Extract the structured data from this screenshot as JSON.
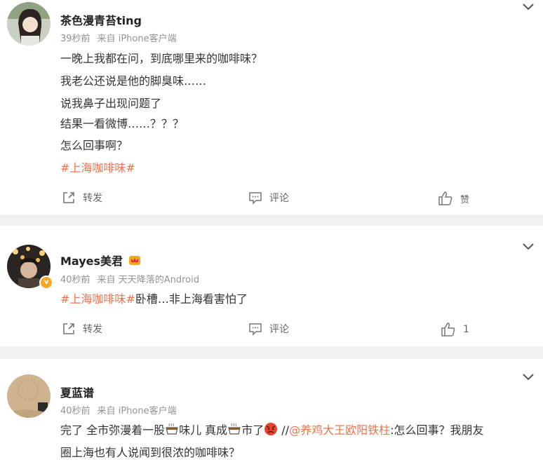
{
  "comments": [
    {
      "username": "茶色漫青苔ting",
      "time": "39秒前",
      "from_prefix": "来自",
      "device": "iPhone客户端",
      "lines": [
        "一晚上我都在问，到底哪里来的咖啡味？",
        "我老公还说是他的脚臭味……",
        "说我鼻子出现问题了",
        "结果一看微博……？？？",
        "怎么回事啊？"
      ],
      "hashtag": "#上海咖啡味#",
      "actions": {
        "forward": "转发",
        "comment": "评论",
        "like": "赞"
      }
    },
    {
      "username": "Mayes美君",
      "time": "40秒前",
      "from_prefix": "来自",
      "device": "天天降落的Android",
      "hashtag": "#上海咖啡味#",
      "text_after_hashtag": "卧槽…非上海看害怕了",
      "actions": {
        "forward": "转发",
        "comment": "评论",
        "like": "1"
      }
    },
    {
      "username": "夏蓝谱",
      "time": "40秒前",
      "from_prefix": "来自",
      "device": "iPhone客户端",
      "line1_a": "完了 全市弥漫着一股",
      "line1_b": "味儿 真成",
      "line1_c": "市了",
      "line1_d": " //",
      "mention": "@养鸡大王欧阳铁柱",
      "line1_e": ":怎么回事？我朋友",
      "line2": "圈上海也有人说闻到很浓的咖啡味？"
    }
  ],
  "colors": {
    "accent": "#eb7350",
    "meta": "#939393",
    "background": "#f2f2f2"
  },
  "icons": [
    "forward-icon",
    "comment-icon",
    "like-icon",
    "chevron-down-icon",
    "coffee-icon",
    "angry-face-icon",
    "crown-icon",
    "verified-badge-icon"
  ]
}
